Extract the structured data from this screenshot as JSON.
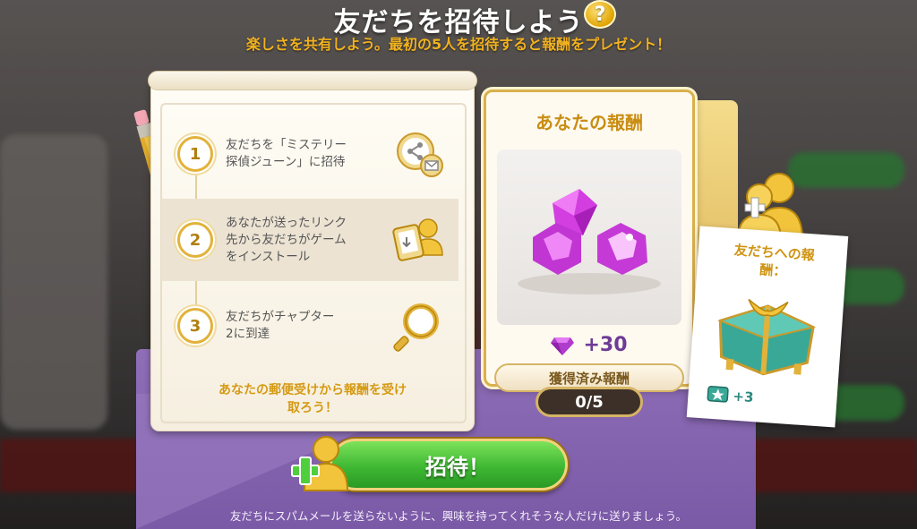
{
  "header": {
    "title": "友だちを招待しよう",
    "help_icon": "question-icon",
    "help_label": "?",
    "subtitle": "楽しさを共有しよう。最初の5人を招待すると報酬をプレゼント！"
  },
  "steps": [
    {
      "number": "1",
      "text": "友だちを「ミステリー\n探偵ジューン」に招待",
      "icon": "share-mail-icon"
    },
    {
      "number": "2",
      "text": "あなたが送ったリンク\n先から友だちがゲーム\nをインストール",
      "icon": "phone-user-icon"
    },
    {
      "number": "3",
      "text": "友だちがチャプター\n2に到達",
      "icon": "magnifier-icon"
    }
  ],
  "scroll_footer": "あなたの郵便受けから報酬を受け\n取ろう！",
  "reward": {
    "title": "あなたの報酬",
    "amount": "+30",
    "currency_icon": "gem-icon",
    "earned_label": "獲得済み報酬",
    "progress": "0/5"
  },
  "friend_reward": {
    "title": "友だちへの報\n酬：",
    "amount": "+3",
    "icon": "star-ticket-icon"
  },
  "invite_button": {
    "label": "招待！",
    "icon": "add-friend-icon"
  },
  "disclaimer": "友だちにスパムメールを送らないように、興味を持ってくれそうな人だけに送りましょう。",
  "colors": {
    "gold": "#d9b04c",
    "accent_text": "#f2b21f",
    "button_green": "#3fb834",
    "gem_purple": "#c03ad8"
  }
}
